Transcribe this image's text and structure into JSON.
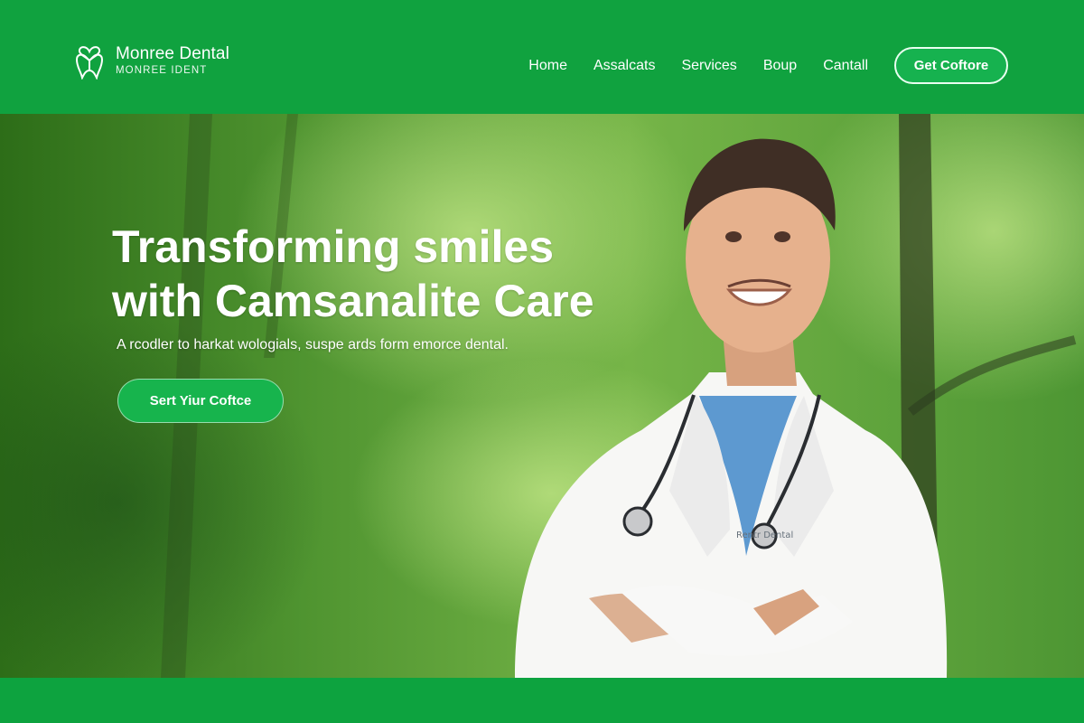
{
  "brand": {
    "name": "Monree Dental",
    "subtitle": "MONREE IDENT",
    "icon": "tooth-heart-icon",
    "accent_color": "#10a23f"
  },
  "nav": {
    "items": [
      "Home",
      "Assalcats",
      "Services",
      "Boup",
      "Cantall"
    ],
    "cta_label": "Get Coftore"
  },
  "hero": {
    "title_line_1": "Transforming smiles",
    "title_line_2": "with Camsanalite Care",
    "subtitle": "A rcodler to harkat wologials, suspe ards form emorce dental.",
    "cta_label": "Sert Yiur Coftce",
    "badge": "Rentr Dental"
  }
}
